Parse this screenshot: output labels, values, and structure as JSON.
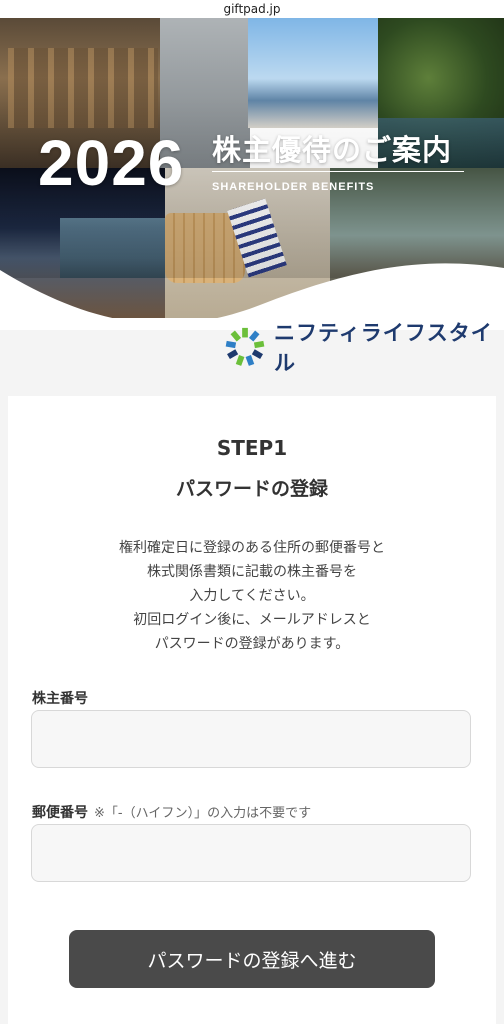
{
  "browser": {
    "url": "giftpad.jp"
  },
  "hero": {
    "year": "2026",
    "title": "株主優待のご案内",
    "subtitle": "SHAREHOLDER BENEFITS"
  },
  "brand": {
    "name": "ニフティライフスタイル",
    "colors": {
      "navy": "#1e3a6e",
      "blue": "#2e7fc6",
      "green": "#6bbf3a"
    }
  },
  "form": {
    "step": "STEP1",
    "step_title": "パスワードの登録",
    "description": [
      "権利確定日に登録のある住所の郵便番号と",
      "株式関係書類に記載の株主番号を",
      "入力してください。",
      "初回ログイン後に、メールアドレスと",
      "パスワードの登録があります。"
    ],
    "shareholder_number": {
      "label": "株主番号",
      "value": "",
      "placeholder": ""
    },
    "postal_code": {
      "label": "郵便番号",
      "note": "※「-（ハイフン）」の入力は不要です",
      "value": "",
      "placeholder": ""
    },
    "submit_label": "パスワードの登録へ進む"
  }
}
